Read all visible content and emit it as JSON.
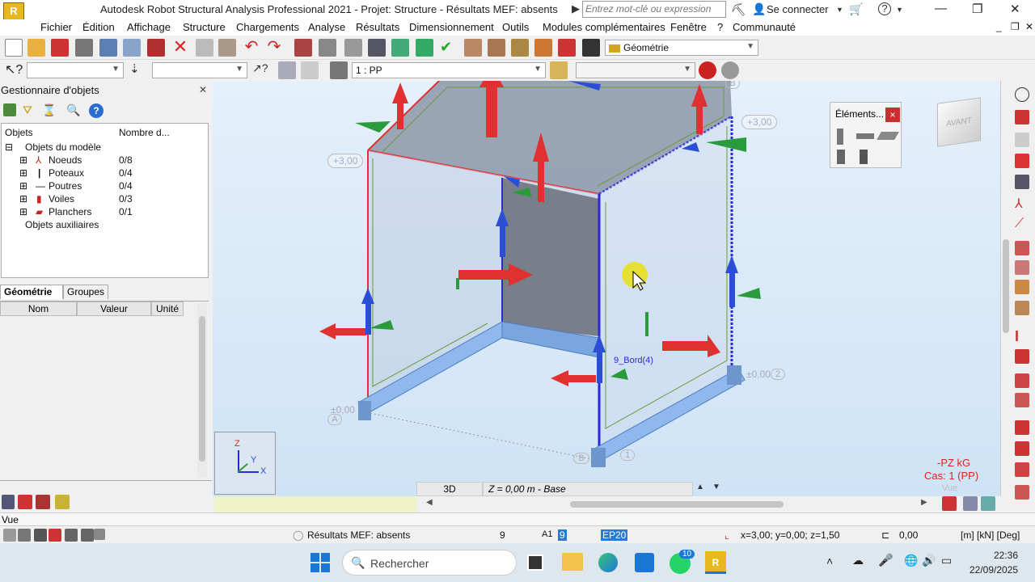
{
  "titlebar": {
    "logo": "R",
    "title": "Autodesk Robot Structural Analysis Professional 2021 - Projet: Structure - Résultats MEF: absents",
    "search_placeholder": "Entrez mot-clé ou expression",
    "connect_label": "Se connecter"
  },
  "menu": [
    "Fichier",
    "Édition",
    "Affichage",
    "Structure",
    "Chargements",
    "Analyse",
    "Résultats",
    "Dimensionnement",
    "Outils",
    "Modules complémentaires",
    "Fenêtre",
    "?",
    "Communauté"
  ],
  "toolbar": {
    "geometry_combo": "Géométrie",
    "case_combo": "1 : PP"
  },
  "object_manager": {
    "title": "Gestionnaire d'objets",
    "col_objects": "Objets",
    "col_count": "Nombre d...",
    "root": "Objets du modèle",
    "items": [
      {
        "label": "Noeuds",
        "count": "0/8"
      },
      {
        "label": "Poteaux",
        "count": "0/4"
      },
      {
        "label": "Poutres",
        "count": "0/4"
      },
      {
        "label": "Voiles",
        "count": "0/3"
      },
      {
        "label": "Planchers",
        "count": "0/1"
      }
    ],
    "aux": "Objets auxiliaires",
    "tab_geometry": "Géométrie",
    "tab_groups": "Groupes",
    "col_name": "Nom",
    "col_value": "Valeur",
    "col_unit": "Unité"
  },
  "viewport": {
    "elements_title": "Éléments...",
    "elements_close": "×",
    "cube_label": "AVANT",
    "level_labels": [
      "+3,00",
      "+3,00",
      "±0,00",
      "±0,00"
    ],
    "axis_labels": [
      "A",
      "B",
      "B",
      "2",
      "1"
    ],
    "edge_label": "9_Bord(4)",
    "legend_line1": "-PZ  kG",
    "legend_line2": "Cas: 1 (PP)",
    "legend_line3": "Vue",
    "triad_z": "Z",
    "triad_y": "Y",
    "triad_x": "X"
  },
  "viewstrip": {
    "view": "3D",
    "level": "Z = 0,00 m - Base"
  },
  "vuebar": {
    "label": "Vue"
  },
  "status": {
    "results": "Résultats MEF: absents",
    "num": "9",
    "num2": "9",
    "section": "EP20",
    "coords": "x=3,00; y=0,00; z=1,50",
    "value": "0,00",
    "units": "[m] [kN] [Deg]"
  },
  "taskbar": {
    "search": "Rechercher",
    "whatsapp_badge": "10",
    "time": "22:36",
    "date": "22/09/2025"
  },
  "colors": {
    "accent": "#e8b820",
    "viewport_bg": "#d9eaf8",
    "load_red": "#e03030",
    "axis_blue": "#2a4fd6",
    "axis_green": "#2a9a3a"
  }
}
